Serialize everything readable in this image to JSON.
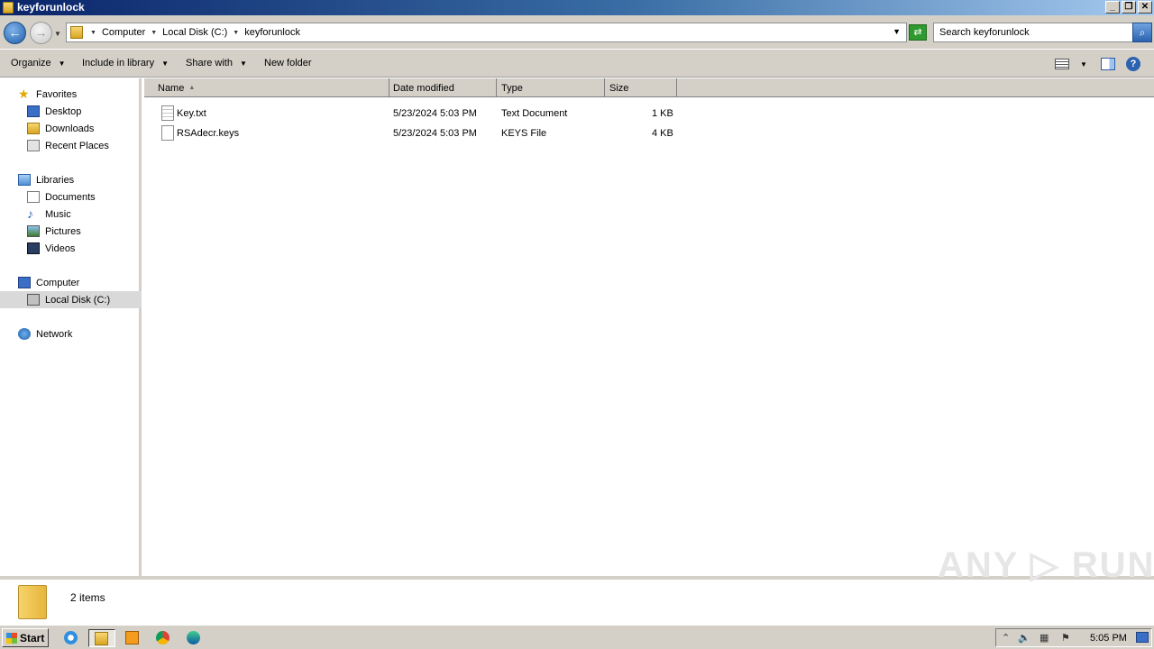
{
  "window": {
    "title": "keyforunlock",
    "controls": {
      "minimize": "_",
      "restore": "❐",
      "close": "✕"
    }
  },
  "address": {
    "breadcrumbs": [
      "Computer",
      "Local Disk (C:)",
      "keyforunlock"
    ],
    "search_placeholder": "Search keyforunlock"
  },
  "toolbar": {
    "organize": "Organize",
    "include_in_library": "Include in library",
    "share_with": "Share with",
    "new_folder": "New folder"
  },
  "nav": {
    "favorites": {
      "label": "Favorites",
      "items": [
        "Desktop",
        "Downloads",
        "Recent Places"
      ]
    },
    "libraries": {
      "label": "Libraries",
      "items": [
        "Documents",
        "Music",
        "Pictures",
        "Videos"
      ]
    },
    "computer": {
      "label": "Computer",
      "items": [
        "Local Disk (C:)"
      ]
    },
    "network": {
      "label": "Network"
    }
  },
  "columns": {
    "name": "Name",
    "date": "Date modified",
    "type": "Type",
    "size": "Size"
  },
  "files": [
    {
      "name": "Key.txt",
      "date": "5/23/2024 5:03 PM",
      "type": "Text Document",
      "size": "1 KB"
    },
    {
      "name": "RSAdecr.keys",
      "date": "5/23/2024 5:03 PM",
      "type": "KEYS File",
      "size": "4 KB"
    }
  ],
  "details": {
    "count": "2 items"
  },
  "watermark": "ANY ▷ RUN",
  "taskbar": {
    "start": "Start",
    "clock": "5:05 PM"
  }
}
